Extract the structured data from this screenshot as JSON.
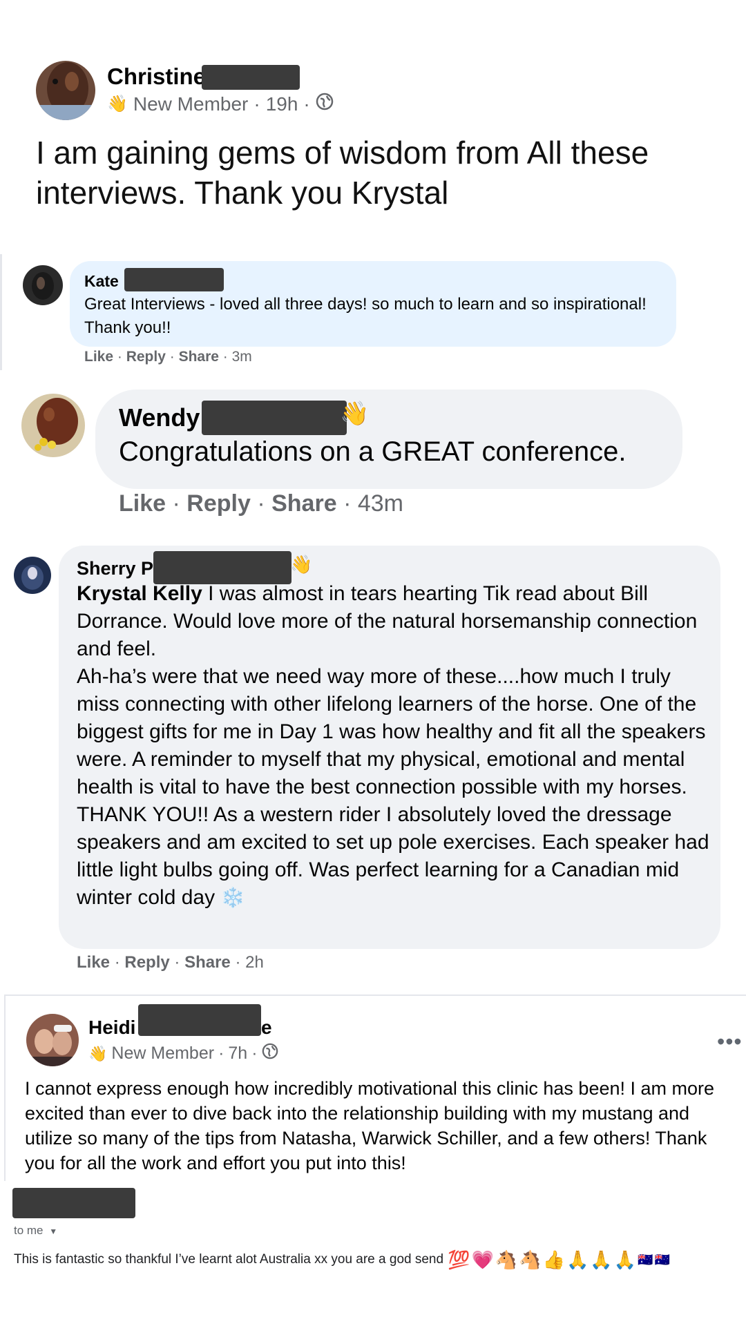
{
  "colors": {
    "bubble_blue": "#e7f3ff",
    "bubble_gray": "#f0f2f5",
    "meta_gray": "#65676b",
    "redaction": "#3b3b3b"
  },
  "post_christine": {
    "author": "Christine",
    "badge": "New Member",
    "time": "19h",
    "privacy_icon": "globe-icon",
    "text": "I am gaining gems of wisdom from All these interviews. Thank you Krystal"
  },
  "comment_kate": {
    "author": "Kate",
    "text": "Great Interviews - loved all three days! so much to learn and so inspirational! Thank you!!",
    "like": "Like",
    "reply": "Reply",
    "share": "Share",
    "time": "3m"
  },
  "comment_wendy": {
    "author": "Wendy",
    "text": "Congratulations on a GREAT conference.",
    "like": "Like",
    "reply": "Reply",
    "share": "Share",
    "time": "43m"
  },
  "comment_sherry": {
    "author": "Sherry P",
    "mention": "Krystal Kelly",
    "text": " I was almost in tears hearting Tik read about Bill Dorrance. Would love more of the natural horsemanship connection and feel.",
    "text2": "Ah-ha’s were that we need way more of these....how much I truly miss connecting with other lifelong learners of the horse. One of the biggest gifts for me in Day 1 was how healthy and fit all the speakers were. A reminder to myself that my physical, emotional and mental health is vital to have the best connection possible with my horses. THANK YOU!! As a western rider I absolutely loved the dressage speakers and am excited to set up pole exercises. Each speaker had little light bulbs going off. Was perfect learning for a Canadian mid winter cold day",
    "end_emoji": "❄️",
    "like": "Like",
    "reply": "Reply",
    "share": "Share",
    "time": "2h"
  },
  "post_heidi": {
    "author": "Heidi",
    "author_tail": "e",
    "badge": "New Member",
    "time": "7h",
    "more": "•••",
    "text": "I cannot express enough how incredibly motivational this clinic has been! I am more excited than ever to dive back into the relationship building with my mustang and utilize so many of the tips from Natasha, Warwick Schiller, and a few others! Thank you for all the work and effort you put into this!"
  },
  "email": {
    "to_label": "to me",
    "text": "This is fantastic so thankful I’ve learnt alot Australia xx  you are a god send",
    "emojis": [
      "💯",
      "💗",
      "🐴",
      "🐴",
      "👍",
      "🙏",
      "🙏",
      "🙏",
      "🇦🇺",
      "🇦🇺"
    ]
  }
}
